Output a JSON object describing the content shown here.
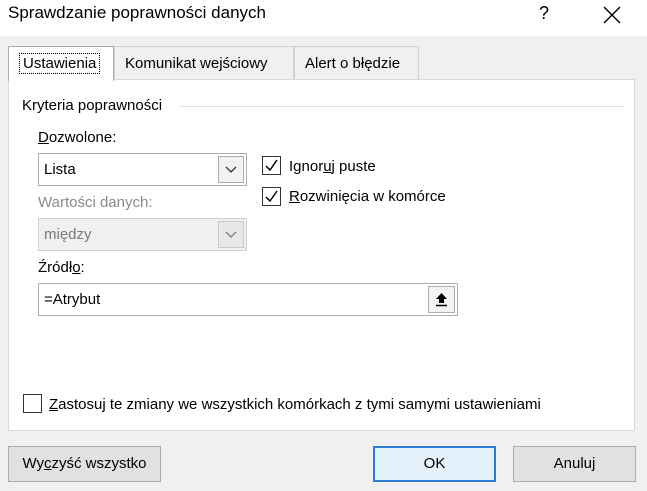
{
  "window": {
    "title": "Sprawdzanie poprawności danych",
    "help_label": "?",
    "close_icon": "close-icon"
  },
  "tabs": [
    {
      "label": "Ustawienia",
      "active": true
    },
    {
      "label": "Komunikat wejściowy",
      "active": false
    },
    {
      "label": "Alert o błędzie",
      "active": false
    }
  ],
  "criteria": {
    "group_label": "Kryteria poprawności",
    "allow": {
      "label_u": "D",
      "label_rest": "ozwolone:",
      "value": "Lista"
    },
    "data": {
      "label": "Wartości danych:",
      "value": "między",
      "enabled": false
    },
    "ignore_blank": {
      "label_a": "Ignor",
      "label_u": "u",
      "label_b": "j puste",
      "checked": true
    },
    "in_cell_dropdown": {
      "label_u": "R",
      "label_rest": "ozwinięcia w komórce",
      "checked": true
    },
    "source": {
      "label_a": "Źródł",
      "label_u": "o",
      "label_b": ":",
      "value": "=Atrybut"
    }
  },
  "apply_all": {
    "label_u": "Z",
    "label_rest": "astosuj te zmiany we wszystkich komórkach z tymi samymi ustawieniami",
    "checked": false
  },
  "buttons": {
    "clear_a": "Wy",
    "clear_u": "c",
    "clear_b": "zyść wszystko",
    "ok": "OK",
    "cancel": "Anuluj"
  }
}
